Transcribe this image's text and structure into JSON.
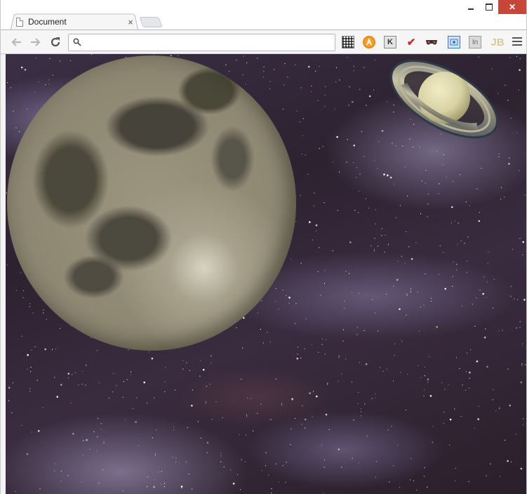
{
  "browser": {
    "tab_title": "Document",
    "tab_close": "×",
    "address": {
      "value": "",
      "placeholder": ""
    },
    "window_controls": {
      "close": "✕"
    }
  },
  "toolbar_icons": [
    "back-arrow-icon",
    "forward-arrow-icon",
    "reload-icon",
    "search-icon",
    "qr-code-extension-icon",
    "avast-extension-icon",
    "k-extension-icon",
    "vk-extension-icon",
    "spy-mask-extension-icon",
    "screenshot-extension-icon",
    "in-extension-icon",
    "jb-extension-icon",
    "chrome-menu-icon"
  ],
  "extension_labels": {
    "k": "K",
    "in": "In",
    "jb": "JB",
    "v": "✔"
  },
  "page": {
    "scene": [
      "moon-image",
      "saturn-image",
      "starfield-background"
    ]
  },
  "colors": {
    "space_dark": "#2d2230",
    "moon_base": "#8e8873",
    "close_button": "#c7463a"
  }
}
